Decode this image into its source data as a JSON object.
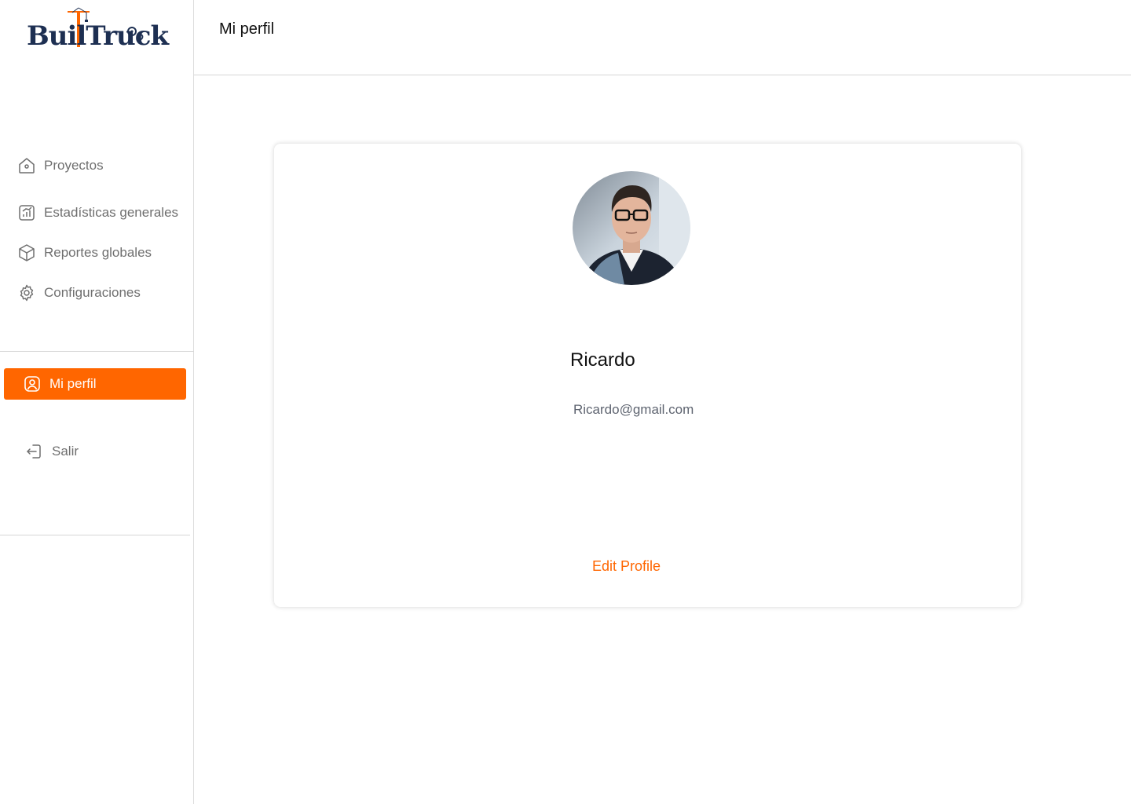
{
  "app": {
    "logo_text": "BuilTruck",
    "brand_color": "#ff6600",
    "brand_dark": "#1d2f52"
  },
  "header": {
    "title": "Mi perfil"
  },
  "sidebar": {
    "items": [
      {
        "label": "Proyectos",
        "icon": "home-icon"
      },
      {
        "label": "Estadísticas generales",
        "icon": "chart-icon"
      },
      {
        "label": "Reportes globales",
        "icon": "box-icon"
      },
      {
        "label": "Configuraciones",
        "icon": "gear-icon"
      }
    ],
    "active_item": {
      "label": "Mi perfil",
      "icon": "user-icon"
    },
    "logout": {
      "label": "Salir",
      "icon": "logout-icon"
    }
  },
  "profile": {
    "name": "Ricardo",
    "email": "Ricardo@gmail.com",
    "edit_label": "Edit Profile"
  }
}
